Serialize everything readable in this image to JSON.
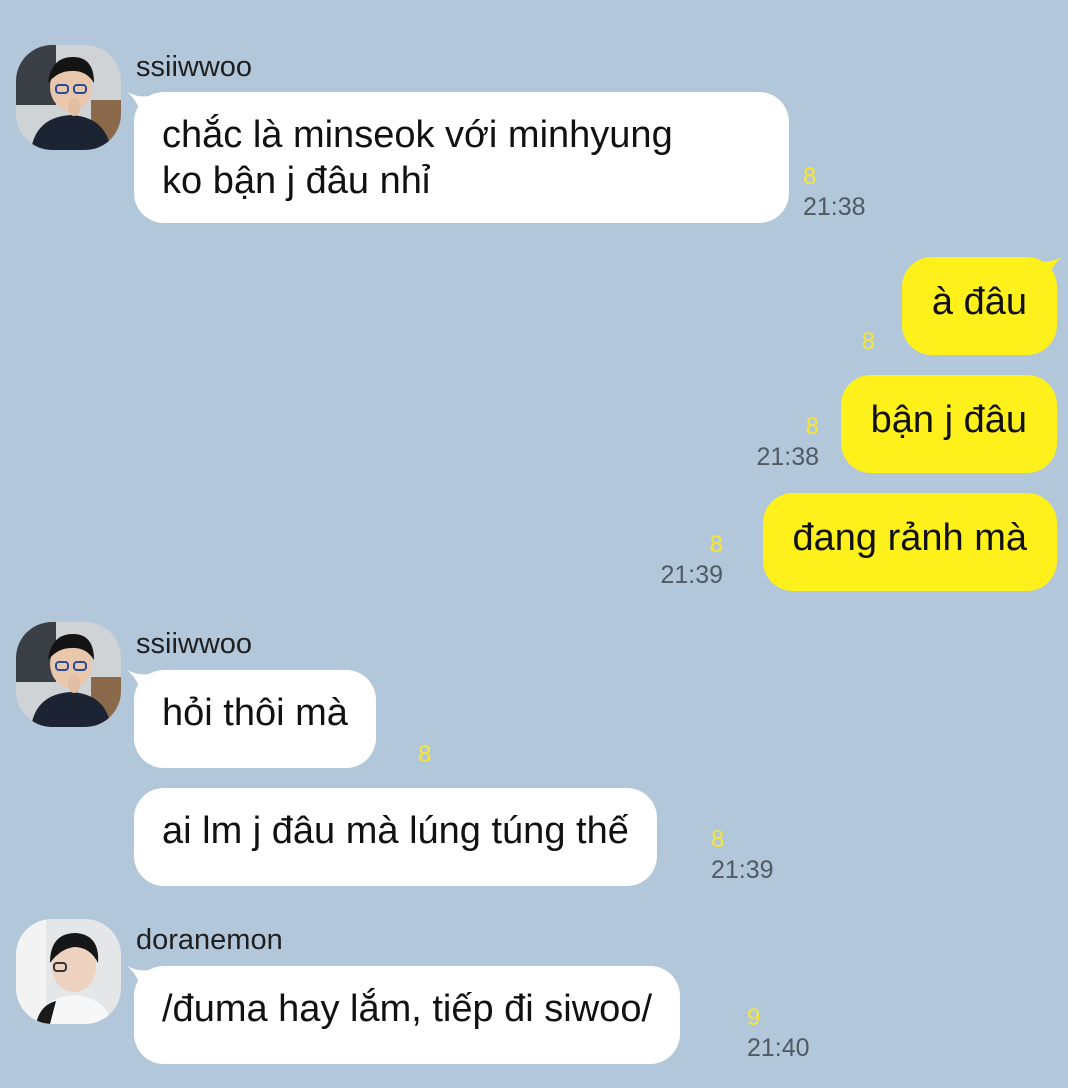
{
  "colors": {
    "background": "#b2c7da",
    "incoming_bubble": "#ffffff",
    "outgoing_bubble": "#fef01b",
    "unread_count": "#f7e632",
    "timestamp": "#4f5a63"
  },
  "messages": {
    "m1": {
      "sender": "ssiiwwoo",
      "text_line1": "chắc là minseok với minhyung",
      "text_line2": "ko bận j đâu nhỉ",
      "unread": "8",
      "time": "21:38"
    },
    "m2": {
      "text": "à đâu",
      "unread": "8"
    },
    "m3": {
      "text": "bận j đâu",
      "unread": "8",
      "time": "21:38"
    },
    "m4": {
      "text": "đang rảnh mà",
      "unread": "8",
      "time": "21:39"
    },
    "m5": {
      "sender": "ssiiwwoo",
      "text": "hỏi thôi mà",
      "unread": "8"
    },
    "m6": {
      "text": "ai lm j đâu mà lúng túng thế",
      "unread": "8",
      "time": "21:39"
    },
    "m7": {
      "sender": "doranemon",
      "text": "/đuma hay lắm, tiếp đi siwoo/",
      "unread": "9",
      "time": "21:40"
    }
  }
}
